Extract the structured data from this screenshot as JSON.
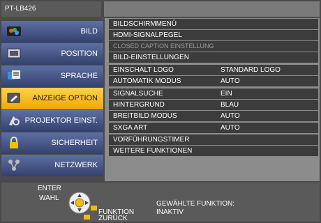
{
  "header": {
    "model": "PT-LB426"
  },
  "sidebar": {
    "items": [
      {
        "label": "BILD"
      },
      {
        "label": "POSITION"
      },
      {
        "label": "SPRACHE"
      },
      {
        "label": "ANZEIGE OPTION"
      },
      {
        "label": "PROJEKTOR EINST."
      },
      {
        "label": "SICHERHEIT"
      },
      {
        "label": "NETZWERK"
      }
    ]
  },
  "menu": {
    "rows": [
      {
        "label": "BILDSCHIRMMENÜ",
        "value": ""
      },
      {
        "label": "HDMI-SIGNALPEGEL",
        "value": ""
      },
      {
        "label": "CLOSED CAPTION EINSTELLUNG",
        "value": ""
      },
      {
        "label": "BILD-EINSTELLUNGEN",
        "value": ""
      },
      {
        "label": "EINSCHALT LOGO",
        "value": "STANDARD LOGO"
      },
      {
        "label": "AUTOMATIK MODUS",
        "value": "AUTO"
      },
      {
        "label": "SIGNALSUCHE",
        "value": "EIN"
      },
      {
        "label": "HINTERGRUND",
        "value": "BLAU"
      },
      {
        "label": "BREITBILD MODUS",
        "value": "AUTO"
      },
      {
        "label": "SXGA ART",
        "value": "AUTO"
      },
      {
        "label": "VORFÜHRUNGSTIMER",
        "value": ""
      },
      {
        "label": "WEITERE FUNKTIONEN",
        "value": ""
      }
    ]
  },
  "footer": {
    "enter": "ENTER",
    "select": "WAHL",
    "function": "FUNKTION",
    "back": "ZURÜCK",
    "selected_label": "GEWÄHLTE FUNKTION:",
    "selected_value": "INAKTIV"
  },
  "colors": {
    "active": "#f5b800",
    "nav": "#3e4c7d",
    "row": "#3c3c3c"
  }
}
